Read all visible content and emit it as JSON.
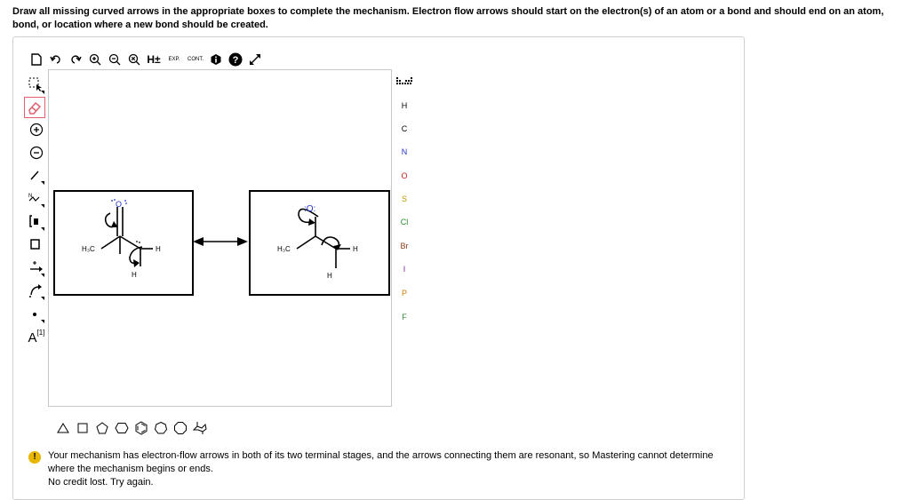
{
  "instructions": "Draw all missing curved arrows in the appropriate boxes to complete the mechanism. Electron flow arrows should start on the electron(s) of an atom or a bond and should end on an atom, bond, or location where a new bond should be created.",
  "toolbar": {
    "h_plus_label": "H±",
    "exp_label": "EXP.",
    "cont_label": "CONT."
  },
  "left_tools": {
    "text_tool_label": "A",
    "atom_map_label": "[1]"
  },
  "elements": [
    "H",
    "C",
    "N",
    "O",
    "S",
    "Cl",
    "Br",
    "I",
    "P",
    "F"
  ],
  "stage_left": {
    "methyl": "H₃C",
    "h_right": "H",
    "h_bottom": "H",
    "oxygen": "O"
  },
  "stage_right": {
    "methyl": "H₃C",
    "h_right": "H",
    "h_bottom": "H",
    "oxygen": ":O:"
  },
  "feedback": {
    "message": "Your mechanism has electron-flow arrows in both of its two terminal stages, and the arrows connecting them are resonant, so Mastering cannot determine where the mechanism begins or ends.",
    "credit": "No credit lost. Try again."
  },
  "colors": {
    "oxygen": "#2233cc",
    "selected_tool_border": "#e06070",
    "feedback_icon": "#e8b500"
  }
}
